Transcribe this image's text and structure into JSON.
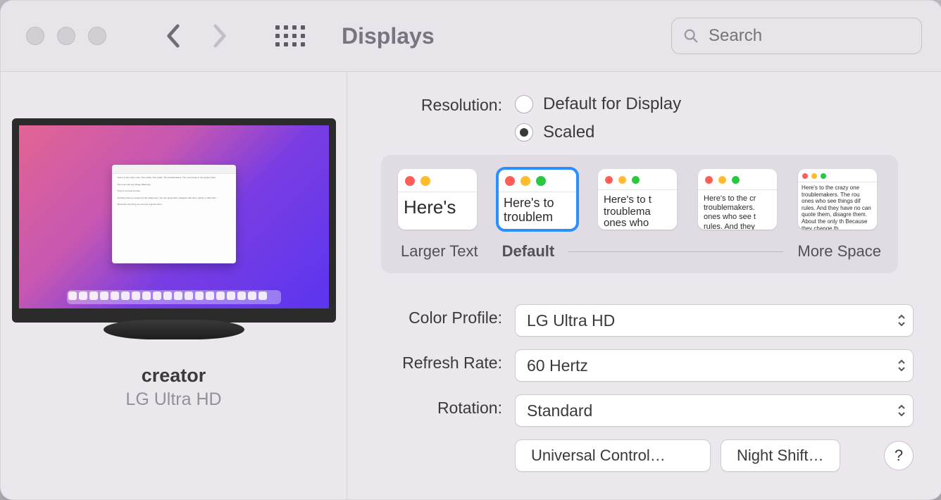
{
  "window": {
    "title": "Displays",
    "search_placeholder": "Search"
  },
  "display": {
    "name": "creator",
    "model": "LG Ultra HD"
  },
  "resolution": {
    "label": "Resolution:",
    "options": {
      "default": "Default for Display",
      "scaled": "Scaled"
    },
    "selected": "scaled",
    "scaling": {
      "larger_text_label": "Larger Text",
      "default_label": "Default",
      "more_space_label": "More Space",
      "samples": [
        "Here's",
        "Here's to troublem",
        "Here's to t troublema ones who",
        "Here's to the cr troublemakers. ones who see t rules. And they",
        "Here's to the crazy one troublemakers. The rou ones who see things dif rules. And they have no can quote them, disagre them. About the only th Because they change th"
      ],
      "selected_index": 1
    }
  },
  "color_profile": {
    "label": "Color Profile:",
    "value": "LG Ultra HD"
  },
  "refresh_rate": {
    "label": "Refresh Rate:",
    "value": "60 Hertz"
  },
  "rotation": {
    "label": "Rotation:",
    "value": "Standard"
  },
  "buttons": {
    "universal_control": "Universal Control…",
    "night_shift": "Night Shift…",
    "help": "?"
  }
}
